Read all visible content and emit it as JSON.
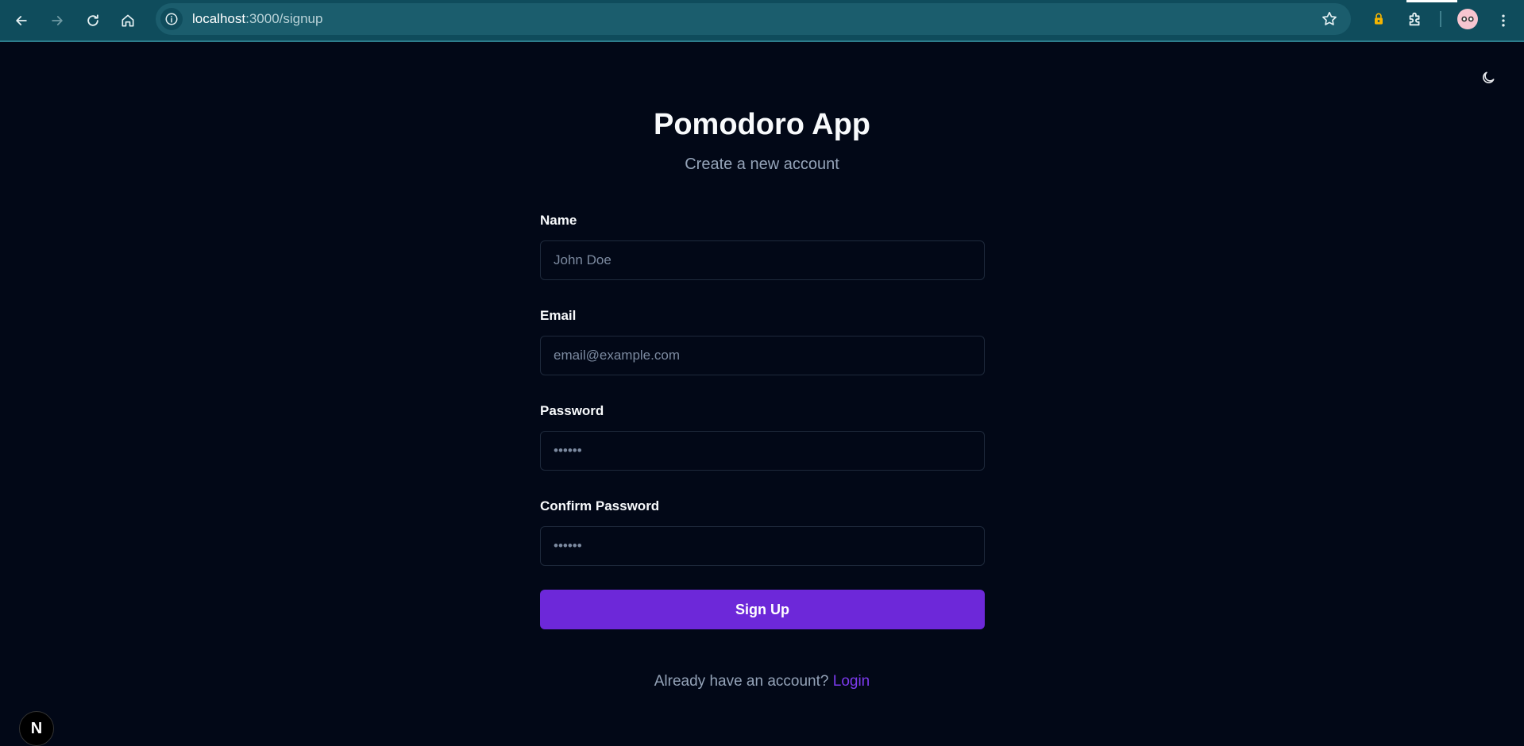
{
  "browser": {
    "url_host": "localhost",
    "url_path": ":3000/signup"
  },
  "page": {
    "title": "Pomodoro App",
    "subtitle": "Create a new account"
  },
  "form": {
    "name": {
      "label": "Name",
      "placeholder": "John Doe"
    },
    "email": {
      "label": "Email",
      "placeholder": "email@example.com"
    },
    "password": {
      "label": "Password",
      "placeholder": "••••••"
    },
    "confirm_password": {
      "label": "Confirm Password",
      "placeholder": "••••••"
    },
    "submit_label": "Sign Up"
  },
  "footer": {
    "prompt": "Already have an account?",
    "link_label": "Login"
  },
  "colors": {
    "background": "#020817",
    "accent": "#6d28d9",
    "link": "#7c3aed",
    "browser_chrome": "#0f4c5c"
  },
  "icons": [
    "back-icon",
    "forward-icon",
    "reload-icon",
    "home-icon",
    "site-info-icon",
    "bookmark-star-icon",
    "password-manager-icon",
    "extensions-icon",
    "profile-avatar",
    "browser-menu-icon",
    "theme-toggle-moon-icon"
  ]
}
